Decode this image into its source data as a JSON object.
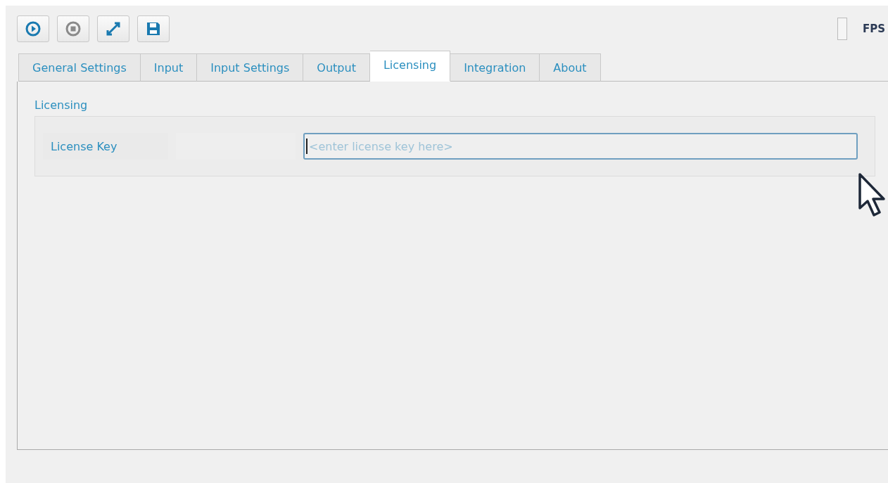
{
  "toolbar": {
    "buttons": [
      {
        "kind": "play"
      },
      {
        "kind": "stop"
      },
      {
        "kind": "expand"
      },
      {
        "kind": "save"
      }
    ]
  },
  "fps": {
    "label": "FPS",
    "checked": false
  },
  "tabs": [
    {
      "label": "General Settings",
      "selected": false
    },
    {
      "label": "Input",
      "selected": false
    },
    {
      "label": "Input Settings",
      "selected": false
    },
    {
      "label": "Output",
      "selected": false
    },
    {
      "label": "Licensing",
      "selected": true
    },
    {
      "label": "Integration",
      "selected": false
    },
    {
      "label": "About",
      "selected": false
    }
  ],
  "group": {
    "title": "Licensing",
    "label": "License Key",
    "placeholder": "<enter license key here>"
  }
}
